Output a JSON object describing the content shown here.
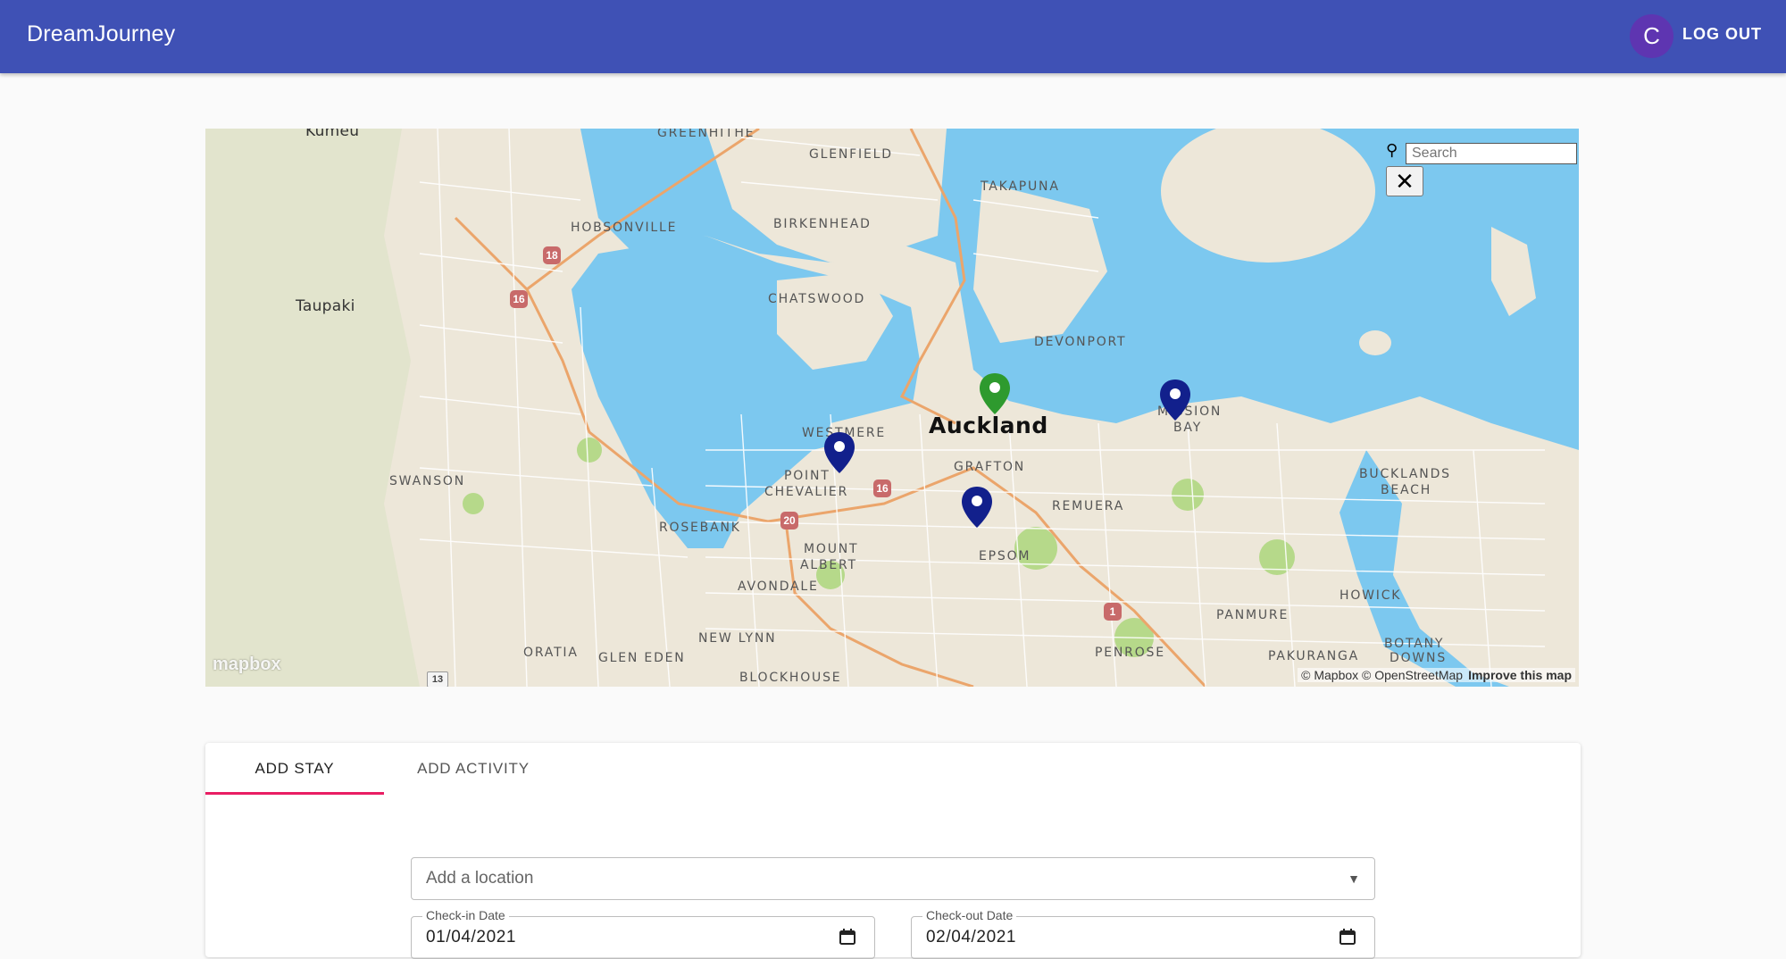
{
  "app": {
    "title": "DreamJourney"
  },
  "user": {
    "avatar_initial": "C",
    "logout_label": "LOG OUT"
  },
  "map": {
    "search_placeholder": "Search",
    "close_symbol": "✕",
    "logo_text": "mapbox",
    "attribution": "© Mapbox © OpenStreetMap",
    "improve_link": "Improve this map",
    "labels": {
      "kumeu": "Kumeu",
      "greenhithe": "GREENHITHE",
      "glenfield": "GLENFIELD",
      "takapuna": "TAKAPUNA",
      "hobsonville": "HOBSONVILLE",
      "birkenhead": "BIRKENHEAD",
      "taupaki": "Taupaki",
      "chatswood": "CHATSWOOD",
      "devonport": "DEVONPORT",
      "westmere": "WESTMERE",
      "auckland": "Auckland",
      "mission": "MISSION",
      "bay": "BAY",
      "grafton": "GRAFTON",
      "point": "POINT",
      "chevalier": "CHEVALIER",
      "swanson": "SWANSON",
      "remuera": "REMUERA",
      "bucklands": "BUCKLANDS",
      "beach": "BEACH",
      "rosebank": "ROSEBANK",
      "mount": "MOUNT",
      "albert": "ALBERT",
      "epsom": "EPSOM",
      "avondale": "AVONDALE",
      "howick": "HOWICK",
      "panmure": "PANMURE",
      "new_lynn": "NEW LYNN",
      "oratia": "ORATIA",
      "glen_eden": "GLEN EDEN",
      "penrose": "PENROSE",
      "pakuranga": "PAKURANGA",
      "botany": "BOTANY",
      "downs": "DOWNS",
      "blockhouse": "BLOCKHOUSE"
    },
    "road_shields": {
      "r18": "18",
      "r16a": "16",
      "r16b": "16",
      "r20": "20",
      "r1": "1",
      "r13": "13"
    },
    "markers": [
      {
        "color": "#2e9a2e",
        "kind": "selected"
      },
      {
        "color": "#12208c",
        "kind": "stay"
      },
      {
        "color": "#12208c",
        "kind": "stay"
      },
      {
        "color": "#12208c",
        "kind": "stay"
      }
    ]
  },
  "tabs": [
    {
      "label": "ADD STAY",
      "active": true
    },
    {
      "label": "ADD ACTIVITY",
      "active": false
    }
  ],
  "form": {
    "location_placeholder": "Add a location",
    "checkin_label": "Check-in Date",
    "checkin_value": "01/04/2021",
    "checkout_label": "Check-out Date",
    "checkout_value": "02/04/2021"
  },
  "colors": {
    "appbar": "#3f51b5",
    "tab_indicator": "#e91e63",
    "water": "#7cc8ef",
    "land": "#ede7d9"
  }
}
